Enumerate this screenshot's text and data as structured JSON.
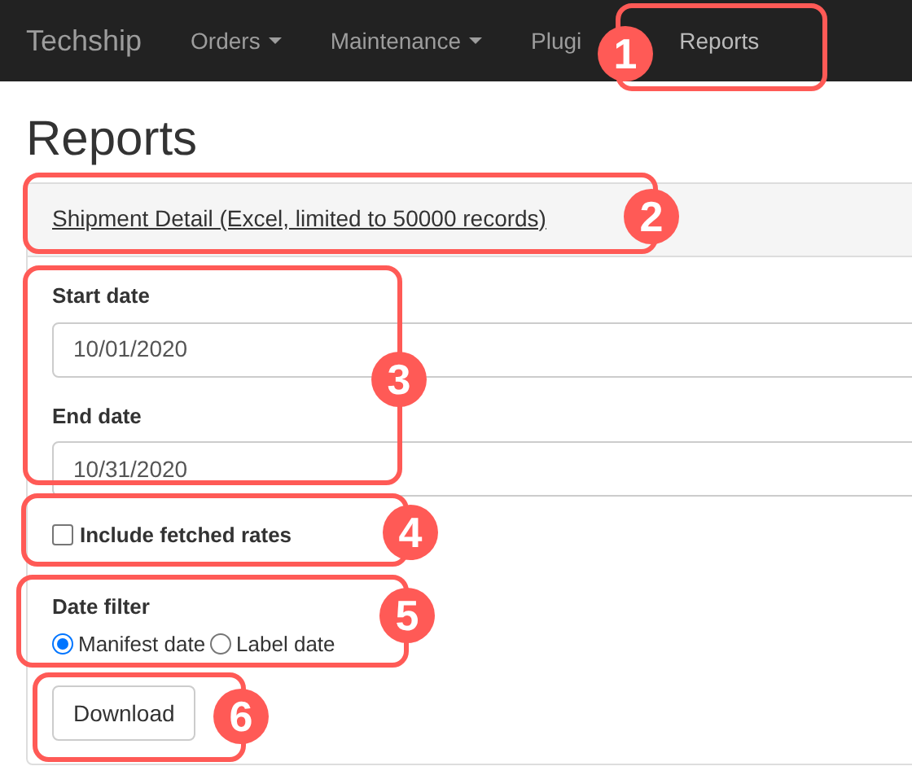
{
  "navbar": {
    "brand": "Techship",
    "items": [
      {
        "label": "Orders",
        "dropdown": true,
        "selected": false
      },
      {
        "label": "Maintenance",
        "dropdown": true,
        "selected": false
      },
      {
        "label": "Plugi",
        "dropdown": false,
        "selected": false
      },
      {
        "label": "Reports",
        "dropdown": false,
        "selected": true
      }
    ]
  },
  "page_title": "Reports",
  "panel": {
    "heading_link": "Shipment Detail (Excel, limited to 50000 records)",
    "fields": [
      {
        "label": "Start date",
        "value": "10/01/2020"
      },
      {
        "label": "End date",
        "value": "10/31/2020"
      }
    ],
    "checkbox": {
      "label": "Include fetched rates",
      "checked": false
    },
    "date_filter": {
      "label": "Date filter",
      "options": [
        {
          "label": "Manifest date",
          "selected": true
        },
        {
          "label": "Label date",
          "selected": false
        }
      ]
    },
    "button": "Download"
  },
  "callouts": [
    "1",
    "2",
    "3",
    "4",
    "5",
    "6"
  ]
}
